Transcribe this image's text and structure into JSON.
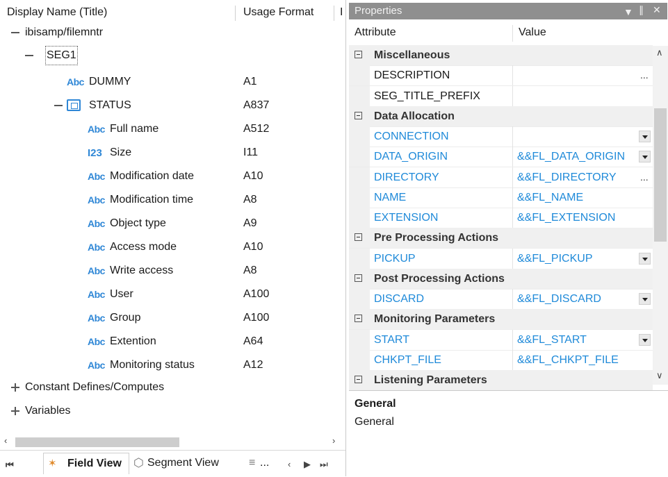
{
  "left_pane": {
    "header": {
      "display_name_col": "Display Name (Title)",
      "usage_format_col": "Usage Format",
      "third_col_fragment": "I"
    },
    "tree": [
      {
        "label": "ibisamp/filemntr",
        "format": "",
        "type": "root"
      },
      {
        "label": "SEG1",
        "format": "",
        "type": "segment"
      },
      {
        "label": "DUMMY",
        "format": "A1",
        "type": "alpha"
      },
      {
        "label": "STATUS",
        "format": "A837",
        "type": "group"
      },
      {
        "label": "Full name",
        "format": "A512",
        "type": "alpha"
      },
      {
        "label": "Size",
        "format": "I11",
        "type": "integer"
      },
      {
        "label": "Modification date",
        "format": "A10",
        "type": "alpha"
      },
      {
        "label": "Modification time",
        "format": "A8",
        "type": "alpha"
      },
      {
        "label": "Object type",
        "format": "A9",
        "type": "alpha"
      },
      {
        "label": "Access mode",
        "format": "A10",
        "type": "alpha"
      },
      {
        "label": "Write access",
        "format": "A8",
        "type": "alpha"
      },
      {
        "label": "User",
        "format": "A100",
        "type": "alpha"
      },
      {
        "label": "Group",
        "format": "A100",
        "type": "alpha"
      },
      {
        "label": "Extention",
        "format": "A64",
        "type": "alpha"
      },
      {
        "label": "Monitoring status",
        "format": "A12",
        "type": "alpha"
      },
      {
        "label": "Constant Defines/Computes",
        "format": "",
        "type": "collapsed"
      },
      {
        "label": "Variables",
        "format": "",
        "type": "collapsed"
      }
    ],
    "icons": {
      "alpha": "Abc",
      "integer": "I23"
    },
    "tabs": {
      "field_view": "Field View",
      "segment_view": "Segment View",
      "overflow": "..."
    }
  },
  "properties": {
    "title": "Properties",
    "columns": {
      "attribute": "Attribute",
      "value": "Value"
    },
    "rows": [
      {
        "kind": "category",
        "label": "Miscellaneous"
      },
      {
        "kind": "prop",
        "attr": "DESCRIPTION",
        "value": "",
        "blue": false,
        "control": "ellipsis"
      },
      {
        "kind": "prop",
        "attr": "SEG_TITLE_PREFIX",
        "value": "",
        "blue": false,
        "control": ""
      },
      {
        "kind": "category",
        "label": "Data Allocation"
      },
      {
        "kind": "prop",
        "attr": "CONNECTION",
        "value": "",
        "blue": true,
        "control": "dropdown"
      },
      {
        "kind": "prop",
        "attr": "DATA_ORIGIN",
        "value": "&&FL_DATA_ORIGIN",
        "blue": true,
        "control": "dropdown"
      },
      {
        "kind": "prop",
        "attr": "DIRECTORY",
        "value": "&&FL_DIRECTORY",
        "blue": true,
        "control": "ellipsis"
      },
      {
        "kind": "prop",
        "attr": "NAME",
        "value": "&&FL_NAME",
        "blue": true,
        "control": ""
      },
      {
        "kind": "prop",
        "attr": "EXTENSION",
        "value": "&&FL_EXTENSION",
        "blue": true,
        "control": ""
      },
      {
        "kind": "category",
        "label": "Pre Processing Actions"
      },
      {
        "kind": "prop",
        "attr": "PICKUP",
        "value": "&&FL_PICKUP",
        "blue": true,
        "control": "dropdown"
      },
      {
        "kind": "category",
        "label": "Post Processing Actions"
      },
      {
        "kind": "prop",
        "attr": "DISCARD",
        "value": "&&FL_DISCARD",
        "blue": true,
        "control": "dropdown"
      },
      {
        "kind": "category",
        "label": "Monitoring Parameters"
      },
      {
        "kind": "prop",
        "attr": "START",
        "value": "&&FL_START",
        "blue": true,
        "control": "dropdown"
      },
      {
        "kind": "prop",
        "attr": "CHKPT_FILE",
        "value": "&&FL_CHKPT_FILE",
        "blue": true,
        "control": ""
      },
      {
        "kind": "category",
        "label": "Listening Parameters"
      }
    ],
    "description": {
      "heading": "General",
      "text": "General"
    }
  },
  "colors": {
    "link_blue": "#1f8ad9",
    "icon_blue": "#2f87d6",
    "titlebar_gray": "#8f8f8f"
  }
}
